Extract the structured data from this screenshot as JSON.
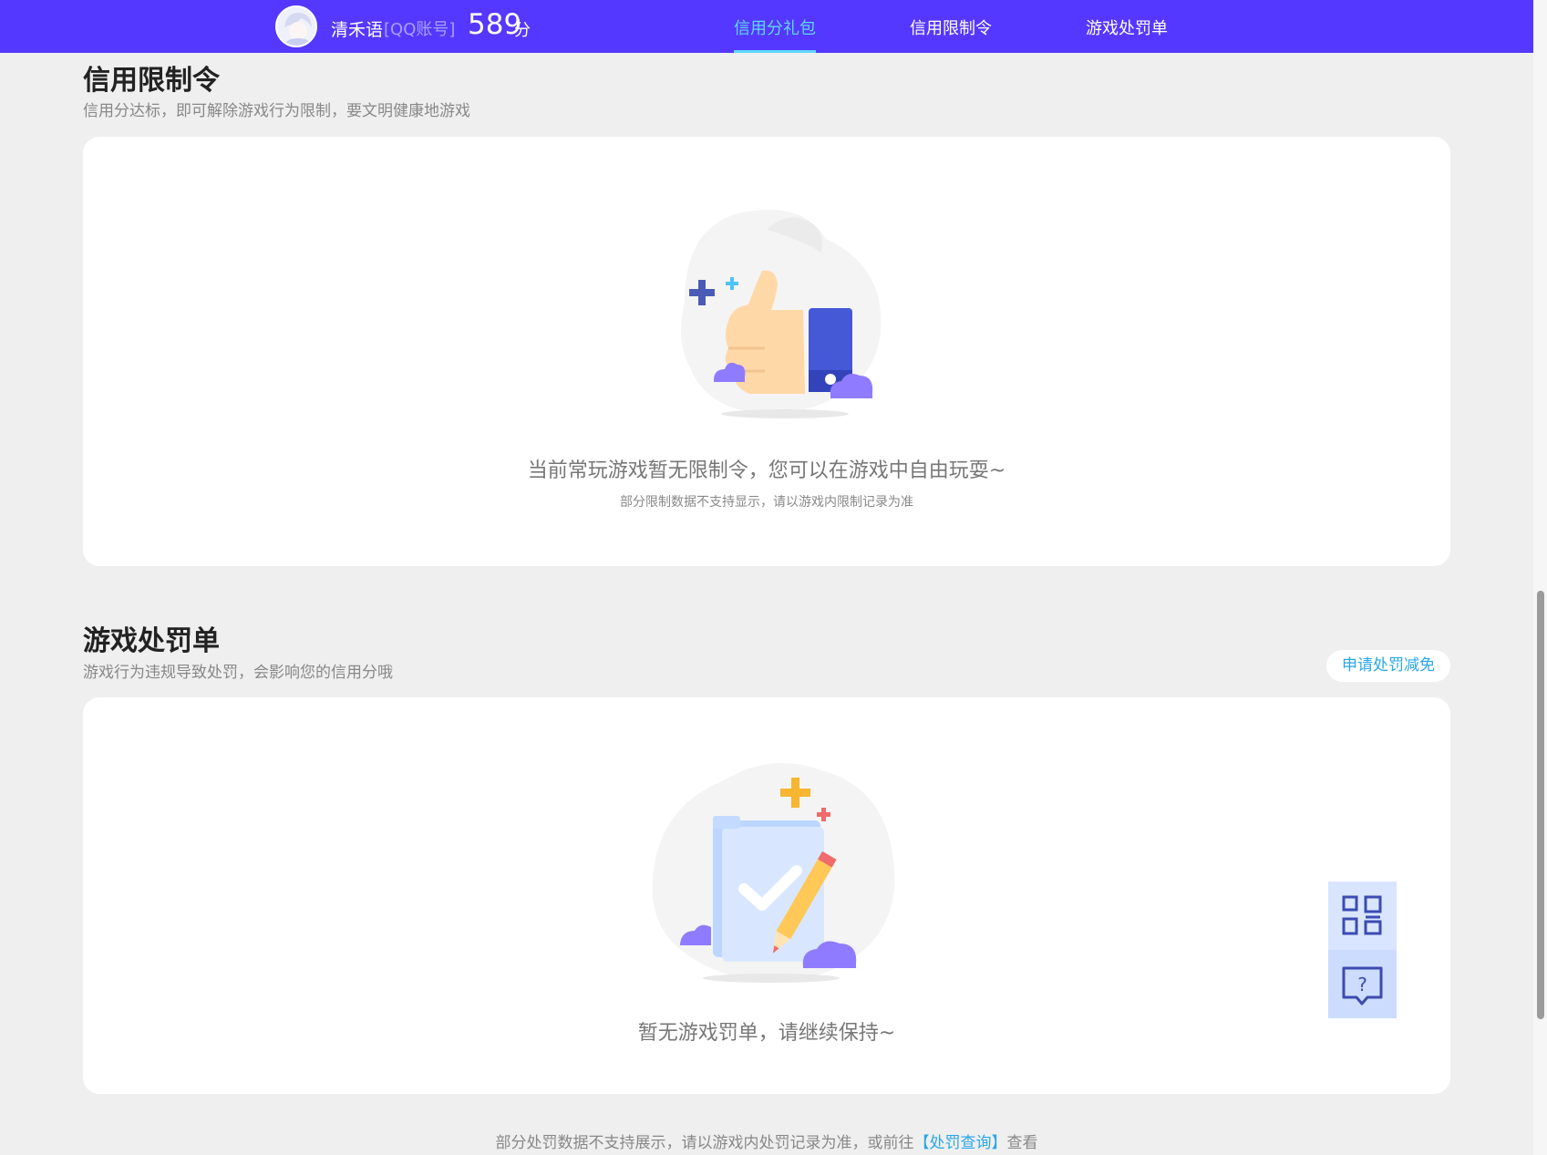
{
  "header": {
    "username": "清禾语",
    "account_type": "[QQ账号]",
    "score": "589",
    "score_unit": "分",
    "tabs": [
      {
        "label": "信用分礼包",
        "active": true
      },
      {
        "label": "信用限制令",
        "active": false
      },
      {
        "label": "游戏处罚单",
        "active": false
      }
    ],
    "accent_color": "#5438ff",
    "active_tab_color": "#5fd7ff"
  },
  "restriction_section": {
    "title": "信用限制令",
    "subtitle": "信用分达标，即可解除游戏行为限制，要文明健康地游戏",
    "empty_message": "当前常玩游戏暂无限制令，您可以在游戏中自由玩耍~",
    "empty_note": "部分限制数据不支持显示，请以游戏内限制记录为准",
    "illustration_icon": "thumbs-up-illustration"
  },
  "penalty_section": {
    "title": "游戏处罚单",
    "subtitle": "游戏行为违规导致处罚，会影响您的信用分哦",
    "appeal_button": "申请处罚减免",
    "empty_message": "暂无游戏罚单，请继续保持~",
    "illustration_icon": "checklist-pencil-illustration"
  },
  "footer": {
    "note_prefix": "部分处罚数据不支持展示，请以游戏内处罚记录为准，或前往",
    "link_label": "【处罚查询】",
    "note_suffix": "查看"
  },
  "floating": {
    "qr_icon": "qr-code-icon",
    "help_icon": "help-chat-icon"
  }
}
